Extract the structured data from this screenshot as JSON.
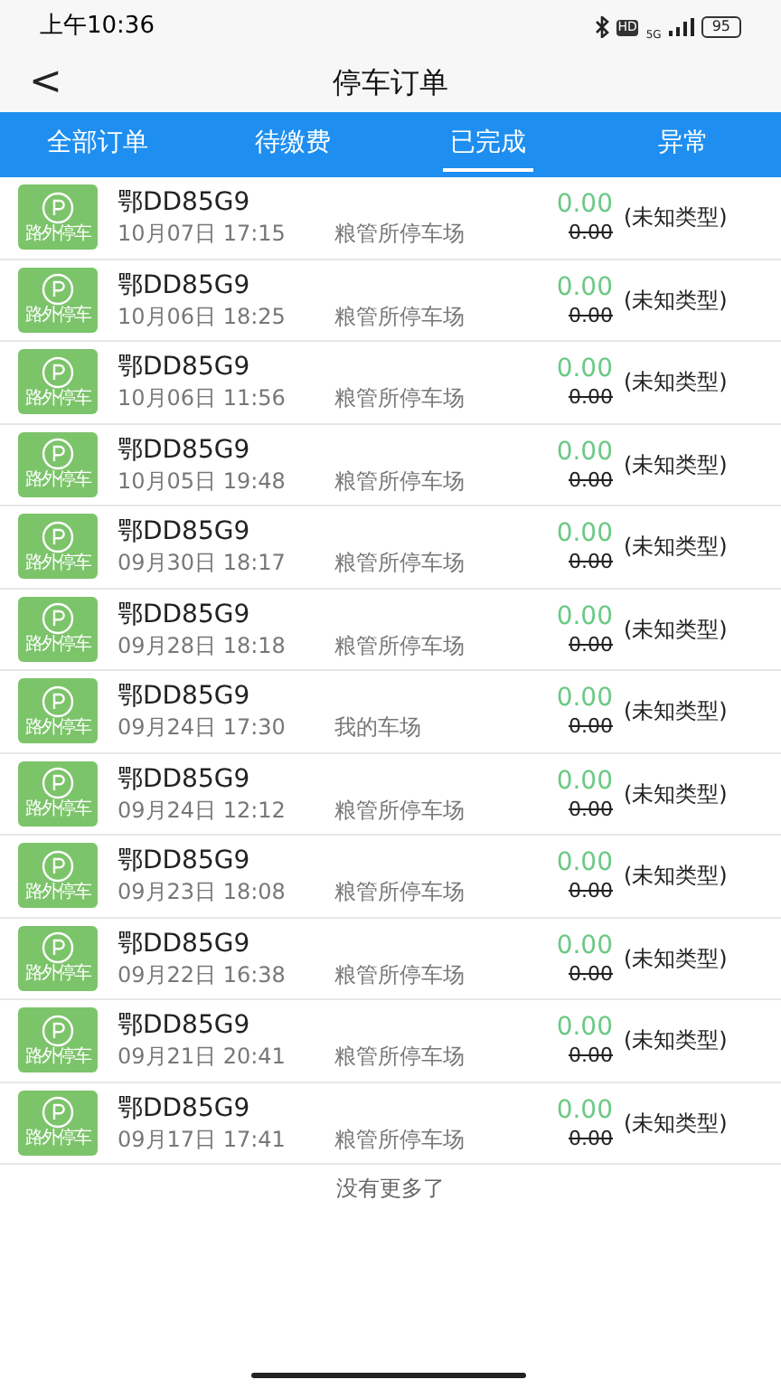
{
  "status_bar": {
    "time": "上午10:36",
    "hd": "HD",
    "network": "5G",
    "battery": "95"
  },
  "header": {
    "back": "<",
    "title": "停车订单"
  },
  "tabs": [
    {
      "label": "全部订单",
      "selected": false
    },
    {
      "label": "待缴费",
      "selected": false
    },
    {
      "label": "已完成",
      "selected": true
    },
    {
      "label": "异常",
      "selected": false
    }
  ],
  "orders": [
    {
      "badge": "路外停车",
      "plate": "鄂DD85G9",
      "time": "10月07日 17:15",
      "lot": "粮管所停车场",
      "paid": "0.00",
      "original": "0.00",
      "type": "(未知类型)"
    },
    {
      "badge": "路外停车",
      "plate": "鄂DD85G9",
      "time": "10月06日 18:25",
      "lot": "粮管所停车场",
      "paid": "0.00",
      "original": "0.00",
      "type": "(未知类型)"
    },
    {
      "badge": "路外停车",
      "plate": "鄂DD85G9",
      "time": "10月06日 11:56",
      "lot": "粮管所停车场",
      "paid": "0.00",
      "original": "0.00",
      "type": "(未知类型)"
    },
    {
      "badge": "路外停车",
      "plate": "鄂DD85G9",
      "time": "10月05日 19:48",
      "lot": "粮管所停车场",
      "paid": "0.00",
      "original": "0.00",
      "type": "(未知类型)"
    },
    {
      "badge": "路外停车",
      "plate": "鄂DD85G9",
      "time": "09月30日 18:17",
      "lot": "粮管所停车场",
      "paid": "0.00",
      "original": "0.00",
      "type": "(未知类型)"
    },
    {
      "badge": "路外停车",
      "plate": "鄂DD85G9",
      "time": "09月28日 18:18",
      "lot": "粮管所停车场",
      "paid": "0.00",
      "original": "0.00",
      "type": "(未知类型)"
    },
    {
      "badge": "路外停车",
      "plate": "鄂DD85G9",
      "time": "09月24日 17:30",
      "lot": "我的车场",
      "paid": "0.00",
      "original": "0.00",
      "type": "(未知类型)"
    },
    {
      "badge": "路外停车",
      "plate": "鄂DD85G9",
      "time": "09月24日 12:12",
      "lot": "粮管所停车场",
      "paid": "0.00",
      "original": "0.00",
      "type": "(未知类型)"
    },
    {
      "badge": "路外停车",
      "plate": "鄂DD85G9",
      "time": "09月23日 18:08",
      "lot": "粮管所停车场",
      "paid": "0.00",
      "original": "0.00",
      "type": "(未知类型)"
    },
    {
      "badge": "路外停车",
      "plate": "鄂DD85G9",
      "time": "09月22日 16:38",
      "lot": "粮管所停车场",
      "paid": "0.00",
      "original": "0.00",
      "type": "(未知类型)"
    },
    {
      "badge": "路外停车",
      "plate": "鄂DD85G9",
      "time": "09月21日 20:41",
      "lot": "粮管所停车场",
      "paid": "0.00",
      "original": "0.00",
      "type": "(未知类型)"
    },
    {
      "badge": "路外停车",
      "plate": "鄂DD85G9",
      "time": "09月17日 17:41",
      "lot": "粮管所停车场",
      "paid": "0.00",
      "original": "0.00",
      "type": "(未知类型)"
    }
  ],
  "footer": "没有更多了"
}
